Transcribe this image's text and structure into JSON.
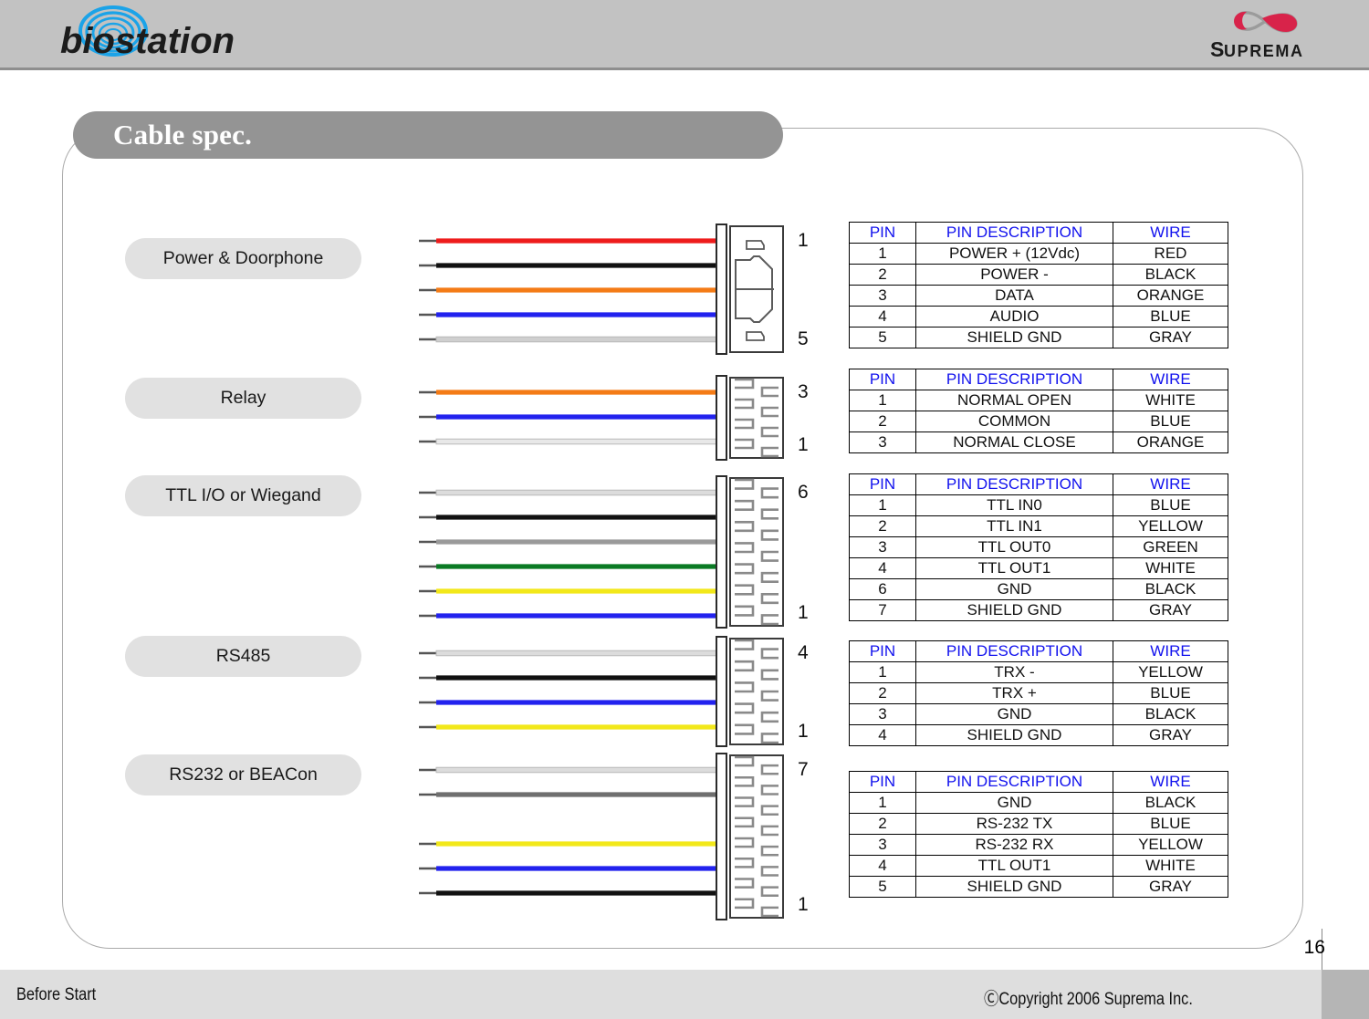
{
  "header": {
    "brand_name": "biostation",
    "company_logo_text": "SUPREMA",
    "brand_accent_color": "#1ba3e8",
    "company_accent_color": "#d8234a"
  },
  "slide": {
    "title": "Cable spec.",
    "page_number": "16"
  },
  "footer": {
    "section_label": "Before Start",
    "copyright": "ⒸCopyright 2006 Suprema Inc."
  },
  "connectors": [
    {
      "label": "Power & Doorphone",
      "pin_top": "1",
      "pin_bottom": "5",
      "connector_style": "molded-plug",
      "wire_colors": [
        "#ee1c1c",
        "#111111",
        "#f47b16",
        "#2222ee",
        "#cfcfcf"
      ],
      "table": {
        "headers": [
          "PIN",
          "PIN DESCRIPTION",
          "WIRE"
        ],
        "rows": [
          [
            "1",
            "POWER + (12Vdc)",
            "RED"
          ],
          [
            "2",
            "POWER -",
            "BLACK"
          ],
          [
            "3",
            "DATA",
            "ORANGE"
          ],
          [
            "4",
            "AUDIO",
            "BLUE"
          ],
          [
            "5",
            "SHIELD GND",
            "GRAY"
          ]
        ]
      }
    },
    {
      "label": "Relay",
      "pin_top": "3",
      "pin_bottom": "1",
      "connector_style": "comb",
      "wire_colors": [
        "#f47b16",
        "#2222ee",
        "#e8e8e8"
      ],
      "table": {
        "headers": [
          "PIN",
          "PIN DESCRIPTION",
          "WIRE"
        ],
        "rows": [
          [
            "1",
            "NORMAL OPEN",
            "WHITE"
          ],
          [
            "2",
            "COMMON",
            "BLUE"
          ],
          [
            "3",
            "NORMAL CLOSE",
            "ORANGE"
          ]
        ]
      }
    },
    {
      "label": "TTL I/O or Wiegand",
      "pin_top": "6",
      "pin_bottom": "1",
      "connector_style": "comb",
      "wire_colors": [
        "#dcdcdc",
        "#111111",
        "#9a9a9a",
        "#0a7a24",
        "#f2e81a",
        "#2222ee"
      ],
      "table": {
        "headers": [
          "PIN",
          "PIN DESCRIPTION",
          "WIRE"
        ],
        "rows": [
          [
            "1",
            "TTL IN0",
            "BLUE"
          ],
          [
            "2",
            "TTL IN1",
            "YELLOW"
          ],
          [
            "3",
            "TTL OUT0",
            "GREEN"
          ],
          [
            "4",
            "TTL OUT1",
            "WHITE"
          ],
          [
            "6",
            "GND",
            "BLACK"
          ],
          [
            "7",
            "SHIELD GND",
            "GRAY"
          ]
        ]
      }
    },
    {
      "label": "RS485",
      "pin_top": "4",
      "pin_bottom": "1",
      "connector_style": "comb",
      "wire_colors": [
        "#dcdcdc",
        "#111111",
        "#2222ee",
        "#f2e81a"
      ],
      "table": {
        "headers": [
          "PIN",
          "PIN DESCRIPTION",
          "WIRE"
        ],
        "rows": [
          [
            "1",
            "TRX -",
            "YELLOW"
          ],
          [
            "2",
            "TRX +",
            "BLUE"
          ],
          [
            "3",
            "GND",
            "BLACK"
          ],
          [
            "4",
            "SHIELD GND",
            "GRAY"
          ]
        ]
      }
    },
    {
      "label": "RS232 or  BEACon",
      "pin_top": "7",
      "pin_bottom": "1",
      "connector_style": "comb",
      "wire_colors": [
        "#dcdcdc",
        "#6f6f6f",
        null,
        "#f2e81a",
        "#2222ee",
        "#111111"
      ],
      "table": {
        "headers": [
          "PIN",
          "PIN DESCRIPTION",
          "WIRE"
        ],
        "rows": [
          [
            "1",
            "GND",
            "BLACK"
          ],
          [
            "2",
            "RS-232 TX",
            "BLUE"
          ],
          [
            "3",
            "RS-232 RX",
            "YELLOW"
          ],
          [
            "4",
            "TTL OUT1",
            "WHITE"
          ],
          [
            "5",
            "SHIELD GND",
            "GRAY"
          ]
        ]
      }
    }
  ]
}
